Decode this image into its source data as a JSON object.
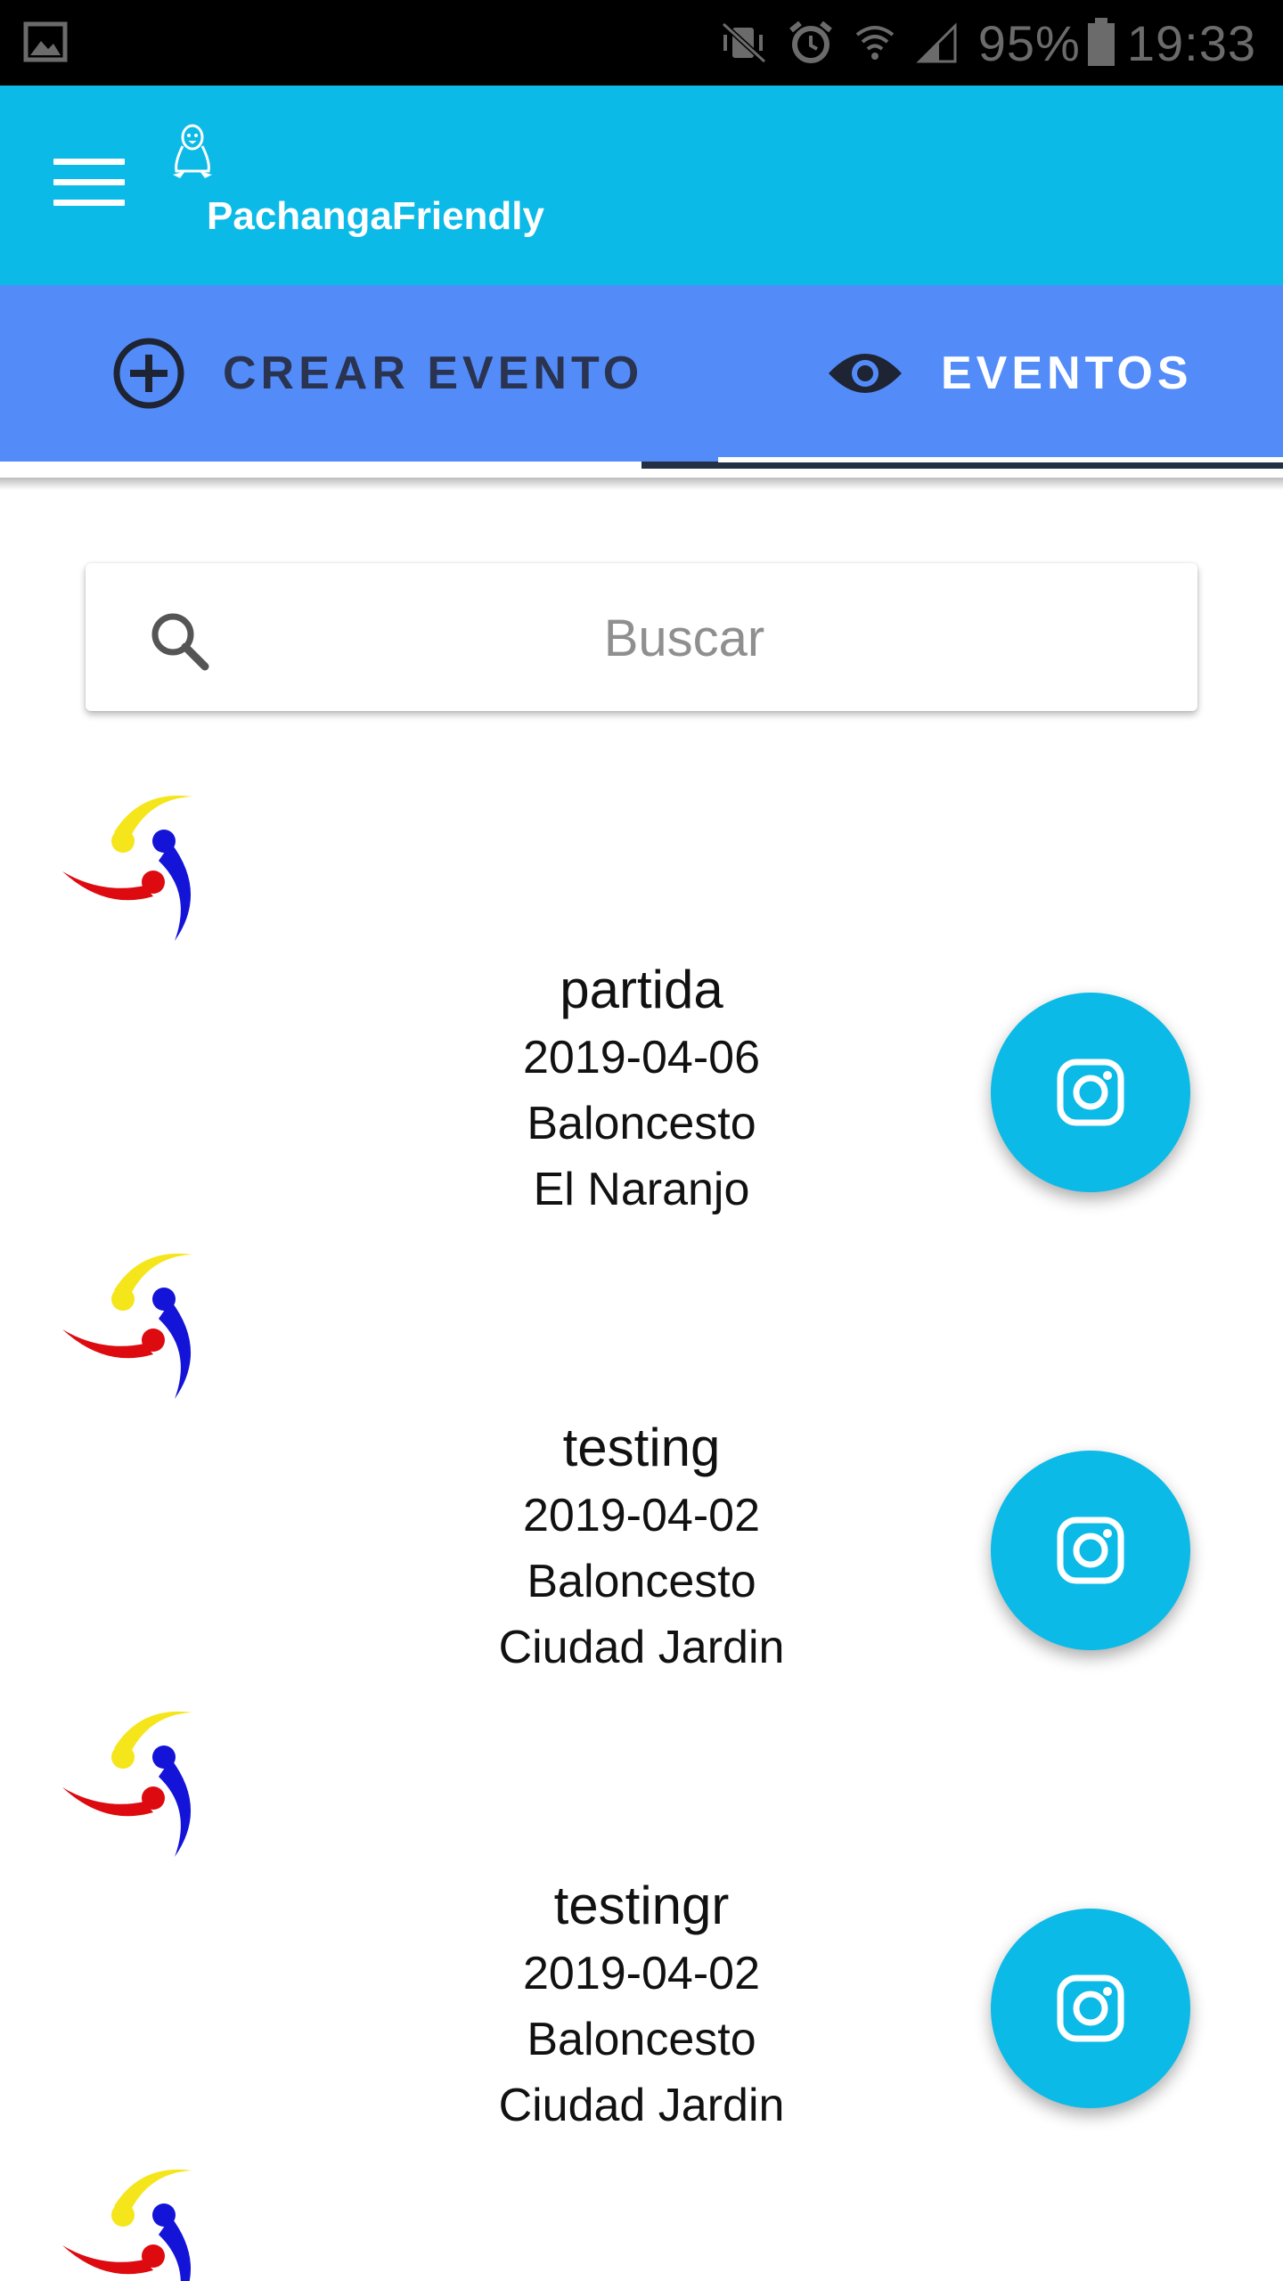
{
  "status_bar": {
    "battery": "95%",
    "time": "19:33"
  },
  "app_bar": {
    "title": "PachangaFriendly"
  },
  "tabs": [
    {
      "label": "CREAR EVENTO",
      "icon": "add-circle-icon",
      "selected": false
    },
    {
      "label": "EVENTOS",
      "icon": "eye-icon",
      "selected": true
    }
  ],
  "search": {
    "placeholder": "Buscar"
  },
  "events": [
    {
      "name": "partida",
      "date": "2019-04-06",
      "sport": "Baloncesto",
      "place": "El Naranjo"
    },
    {
      "name": "testing",
      "date": "2019-04-02",
      "sport": "Baloncesto",
      "place": "Ciudad Jardin"
    },
    {
      "name": "testingr",
      "date": "2019-04-02",
      "sport": "Baloncesto",
      "place": "Ciudad Jardin"
    }
  ],
  "colors": {
    "app_bar": "#0bbae6",
    "tab_bar": "#538cf9",
    "fab": "#0bbae6",
    "logo_yellow": "#f5e51b",
    "logo_blue": "#1414d8",
    "logo_red": "#dd0b10"
  }
}
